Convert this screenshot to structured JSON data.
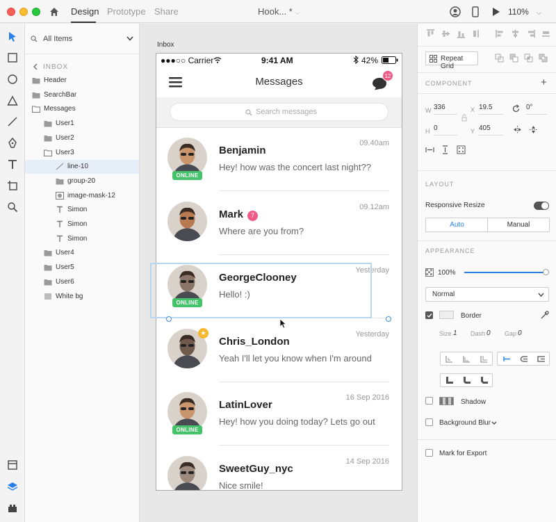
{
  "app": {
    "mode_tabs": [
      "Design",
      "Prototype",
      "Share"
    ],
    "doc_title": "Hook... *",
    "zoom": "110%"
  },
  "layers": {
    "filter": "All Items",
    "crumb": "INBOX",
    "items": [
      {
        "label": "Header",
        "icon": "folder-icon",
        "indent": 0
      },
      {
        "label": "SearchBar",
        "icon": "folder-icon",
        "indent": 0
      },
      {
        "label": "Messages",
        "icon": "folder-open-icon",
        "indent": 0
      },
      {
        "label": "User1",
        "icon": "folder-icon",
        "indent": 1
      },
      {
        "label": "User2",
        "icon": "folder-icon",
        "indent": 1
      },
      {
        "label": "User3",
        "icon": "folder-open-icon",
        "indent": 1
      },
      {
        "label": "line-10",
        "icon": "line-icon",
        "indent": 2,
        "selected": true
      },
      {
        "label": "group-20",
        "icon": "folder-icon",
        "indent": 2
      },
      {
        "label": "image-mask-12",
        "icon": "mask-icon",
        "indent": 2
      },
      {
        "label": "Simon",
        "icon": "text-icon",
        "indent": 2
      },
      {
        "label": "Simon",
        "icon": "text-icon",
        "indent": 2
      },
      {
        "label": "Simon",
        "icon": "text-icon",
        "indent": 2
      },
      {
        "label": "User4",
        "icon": "folder-icon",
        "indent": 1
      },
      {
        "label": "User5",
        "icon": "folder-icon",
        "indent": 1
      },
      {
        "label": "User6",
        "icon": "folder-icon",
        "indent": 1
      },
      {
        "label": "White bg",
        "icon": "rectangle-icon",
        "indent": 1
      }
    ]
  },
  "canvas": {
    "artboard": "Inbox",
    "status": {
      "carrier": "●●●○○ Carrier",
      "time": "9:41 AM",
      "battery": "42%"
    },
    "nav_title": "Messages",
    "nav_badge": "12",
    "search_placeholder": "Search messages",
    "online_label": "ONLINE",
    "messages": [
      {
        "name": "Benjamin",
        "preview": "Hey! how was the concert last night??",
        "time": "09.40am",
        "online": true,
        "badge": "",
        "star": false,
        "avatar": "#c8956d"
      },
      {
        "name": "Mark",
        "preview": "Where are you from?",
        "time": "09.12am",
        "online": false,
        "badge": "7",
        "star": false,
        "avatar": "#b97a52"
      },
      {
        "name": "GeorgeClooney",
        "preview": "Hello! :)",
        "time": "Yesterday",
        "online": true,
        "badge": "",
        "star": false,
        "avatar": "#8a7568"
      },
      {
        "name": "Chris_London",
        "preview": "Yeah I'll let you know when I'm around",
        "time": "Yesterday",
        "online": false,
        "badge": "",
        "star": true,
        "avatar": "#6f5a4c"
      },
      {
        "name": "LatinLover",
        "preview": "Hey! how you doing today? Lets go out",
        "time": "16 Sep 2016",
        "online": true,
        "badge": "",
        "star": false,
        "avatar": "#c8956d"
      },
      {
        "name": "SweetGuy_nyc",
        "preview": "Nice smile!",
        "time": "14 Sep 2016",
        "online": false,
        "badge": "",
        "star": false,
        "avatar": "#9d8a7c"
      }
    ]
  },
  "inspector": {
    "repeat_grid": "Repeat Grid",
    "component": "COMPONENT",
    "w_label": "W",
    "w": "336",
    "h_label": "H",
    "h": "0",
    "x_label": "X",
    "x": "19.5",
    "y_label": "Y",
    "y": "405",
    "rotation": "0°",
    "layout": "LAYOUT",
    "responsive_resize": "Responsive Resize",
    "auto": "Auto",
    "manual": "Manual",
    "appearance": "APPEARANCE",
    "opacity": "100%",
    "blend": "Normal",
    "border": "Border",
    "size_label": "Size",
    "size": "1",
    "dash_label": "Dash",
    "dash": "0",
    "gap_label": "Gap",
    "gap": "0",
    "shadow": "Shadow",
    "background_blur": "Background Blur",
    "mark_export": "Mark for Export",
    "accent": "#2680eb"
  }
}
